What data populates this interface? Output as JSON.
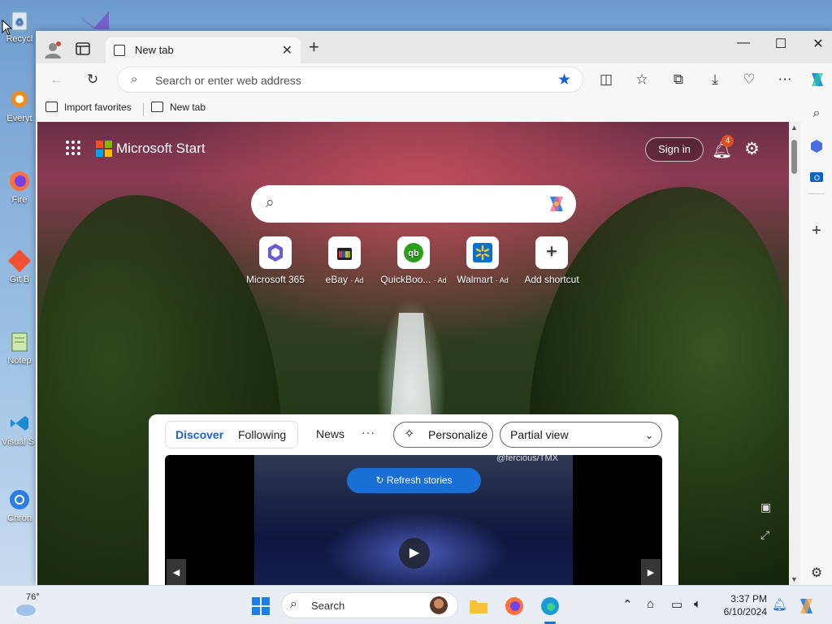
{
  "desktop": {
    "icons": [
      {
        "label": "Recycl"
      },
      {
        "label": "Everyt"
      },
      {
        "label": "Fire"
      },
      {
        "label": "Git B"
      },
      {
        "label": "Notep"
      },
      {
        "label": "Visual S Co"
      },
      {
        "label": "Chron"
      }
    ]
  },
  "browser": {
    "tab": {
      "title": "New tab",
      "close": "✕"
    },
    "window_controls": {
      "minimize": "—",
      "maximize": "☐",
      "close": "✕"
    },
    "address": {
      "placeholder": "Search or enter web address"
    },
    "favorites": [
      {
        "label": "Import favorites"
      },
      {
        "label": "New tab"
      }
    ]
  },
  "page": {
    "brand": "Microsoft Start",
    "sign_in": "Sign in",
    "notification_count": "4",
    "shortcuts": [
      {
        "label": "Microsoft 365",
        "ad": ""
      },
      {
        "label": "eBay",
        "ad": "· Ad"
      },
      {
        "label": "QuickBoo...",
        "ad": "· Ad"
      },
      {
        "label": "Walmart",
        "ad": "· Ad"
      },
      {
        "label": "Add shortcut",
        "ad": ""
      }
    ],
    "feed": {
      "tabs": [
        "Discover",
        "Following"
      ],
      "news": "News",
      "more": "···",
      "personalize": "Personalize",
      "view": "Partial view",
      "story_credit": "@fercious/TMX",
      "refresh": "Refresh stories"
    }
  },
  "taskbar": {
    "temperature": "76°",
    "search": "Search",
    "time": "3:37 PM",
    "date": "6/10/2024"
  },
  "colors": {
    "accent": "#1a5fd6",
    "badge": "#e0501e"
  }
}
